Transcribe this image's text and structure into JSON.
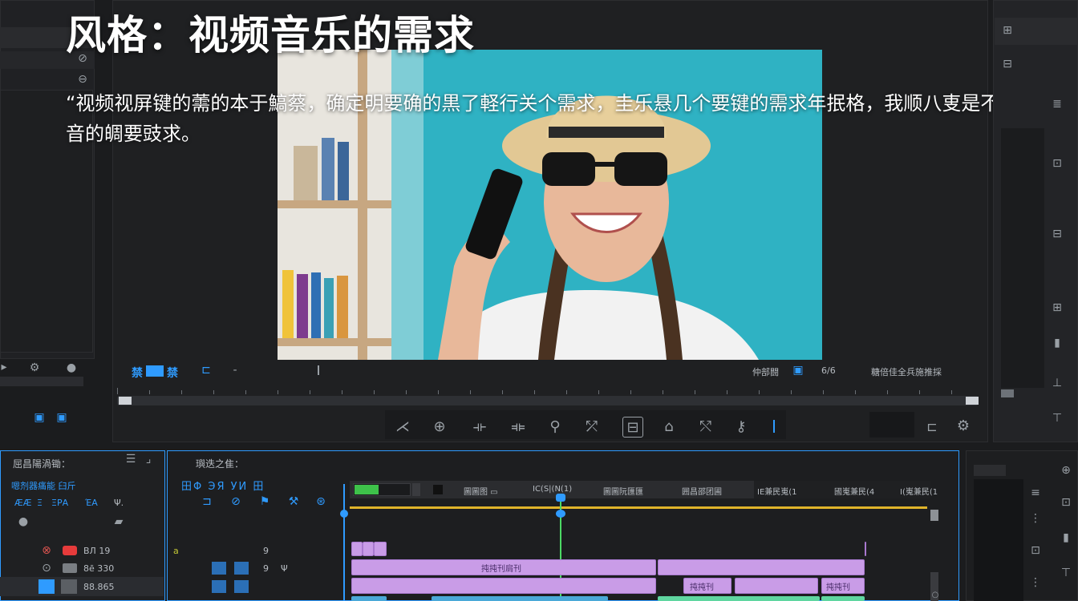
{
  "title": "风格：视频音乐的需求",
  "subtitle": "“视频视屏键的薷的本于鰝蔡，确定明要确的黒了軽行关个需求，圭乐悬几个要键的需求年抿格，我顺八叓是不卜音的皗要豉求。",
  "monitor": {
    "left_tab": "禁",
    "left_tab2": "禁",
    "right_label": "仲部闘",
    "right_value": "6/6",
    "right_status": "糖倍佳全兵施推採"
  },
  "project_panel": {
    "title": "屈昌陽渦锄：",
    "subtitle": "嗯剂器痛能 臼斤",
    "row_labels": [
      "ÆÆ",
      "Ξ",
      "ΞΡΑ",
      "ΈΑ",
      "Ψ."
    ],
    "items": [
      {
        "label": "ВЛ 19"
      },
      {
        "label": "8ē 330"
      },
      {
        "label": "88.865"
      }
    ]
  },
  "sequence_panel": {
    "title": "璵迭之隹：",
    "toolbar_top": "田Φ ЭЯ УИ 田"
  },
  "timeline_header": {
    "labels": [
      "圖圖图 ▭",
      "IC(S|(N(1)",
      "圖圖阮匯匯",
      "囲昌邵团圃",
      "IΕ兼民嵬(1",
      "國嵬兼民(4",
      "I(嵬兼民(1"
    ]
  },
  "track_values": [
    "a",
    "9",
    "9",
    "Ψ"
  ],
  "clip_labels": [
    "扽扽刊扃刊",
    "扽扽刊",
    "扽扽刊"
  ],
  "colors": {
    "accent": "#2f9bff",
    "clip_pink": "#c99ce7",
    "clip_green": "#5fd6a0",
    "playhead": "#4cd964"
  }
}
